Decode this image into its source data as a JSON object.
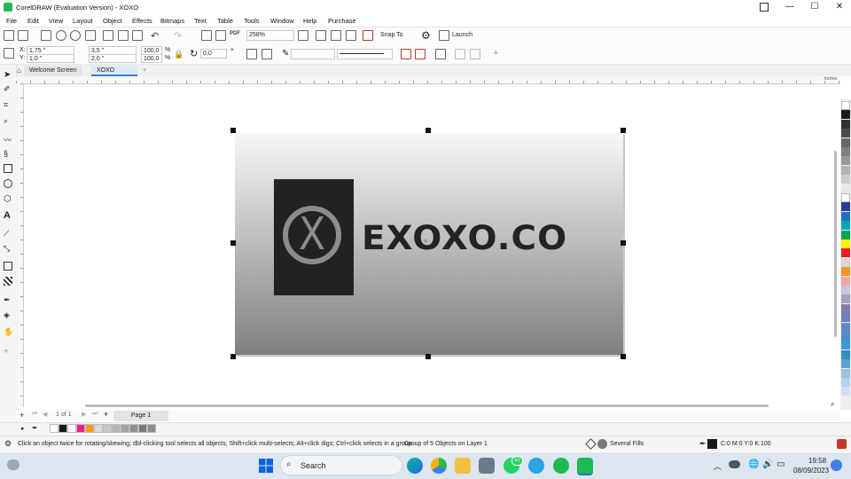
{
  "window": {
    "title": "CorelDRAW (Evaluation Version) - XOXO",
    "minimize": "—",
    "maximize": "☐",
    "close": "✕"
  },
  "menu": [
    "File",
    "Edit",
    "View",
    "Layout",
    "Object",
    "Effects",
    "Bitmaps",
    "Text",
    "Table",
    "Tools",
    "Window",
    "Help",
    "Purchase"
  ],
  "toolbar": {
    "zoom_value": "258%",
    "pdf_label": "PDF",
    "snap_to_label": "Snap To",
    "launch_label": "Launch"
  },
  "properties": {
    "x_label": "X:",
    "x_value": "1,75 \"",
    "y_label": "Y:",
    "y_value": "1,0 \"",
    "width_value": "3,5 \"",
    "height_value": "2,0 \"",
    "scale_w": "100,0",
    "scale_h": "100,0",
    "scale_unit": "%",
    "rotation": "0,0",
    "degree": "°"
  },
  "tabs": {
    "welcome": "Welcome Screen",
    "document": "XOXO",
    "add": "+"
  },
  "ruler_unit": "inches",
  "artwork": {
    "brand_text": "EXOXO.CO",
    "logo_glyph": "X",
    "block_color": "#222222",
    "ring_color": "#8c8c8c"
  },
  "page_nav": {
    "page_count": "1 of 1",
    "page_tab": "Page 1"
  },
  "status": {
    "hint": "Click an object twice for rotating/skewing; dbl-clicking tool selects all objects; Shift+click multi-selects; Alt+click digs; Ctrl+click selects in a group",
    "selection": "Group of 5 Objects on Layer 1",
    "fill": "Several Fills",
    "outline": "C:0 M:0 Y:0 K:100"
  },
  "taskbar": {
    "search_label": "Search",
    "time": "19:58",
    "date": "08/09/2023",
    "whatsapp_badge": "10"
  },
  "colors": {
    "accent": "#1db954",
    "selection_handles": "#111111"
  },
  "doc_palette": [
    "#ffffff",
    "#1a1a1a",
    "#ffffff",
    "#e91e8c",
    "#f39c12",
    "#d9d9d9",
    "#c8c8c8",
    "#b5b5b5",
    "#a3a3a3",
    "#8f8f8f",
    "#7a7a7a",
    "#8e8e8e"
  ],
  "right_palette": [
    "#ffffff",
    "#1a1a1a",
    "#333333",
    "#4d4d4d",
    "#666666",
    "#808080",
    "#999999",
    "#b3b3b3",
    "#cccccc",
    "#e6e6e6",
    "#ffffff",
    "#2b3a8f",
    "#1b6fc2",
    "#00a3c4",
    "#00a651",
    "#fff200",
    "#ed1c24",
    "#d5d5d5",
    "#f7941d",
    "#f4a6a6",
    "#c8c8d8",
    "#a1a1c8",
    "#8080b0",
    "#6c7fbf",
    "#5f86c6",
    "#4a90c9",
    "#3a9ad9",
    "#2f8fc1",
    "#5aa5d6",
    "#9ac3e6",
    "#b4d2ea",
    "#cfe1f1"
  ]
}
